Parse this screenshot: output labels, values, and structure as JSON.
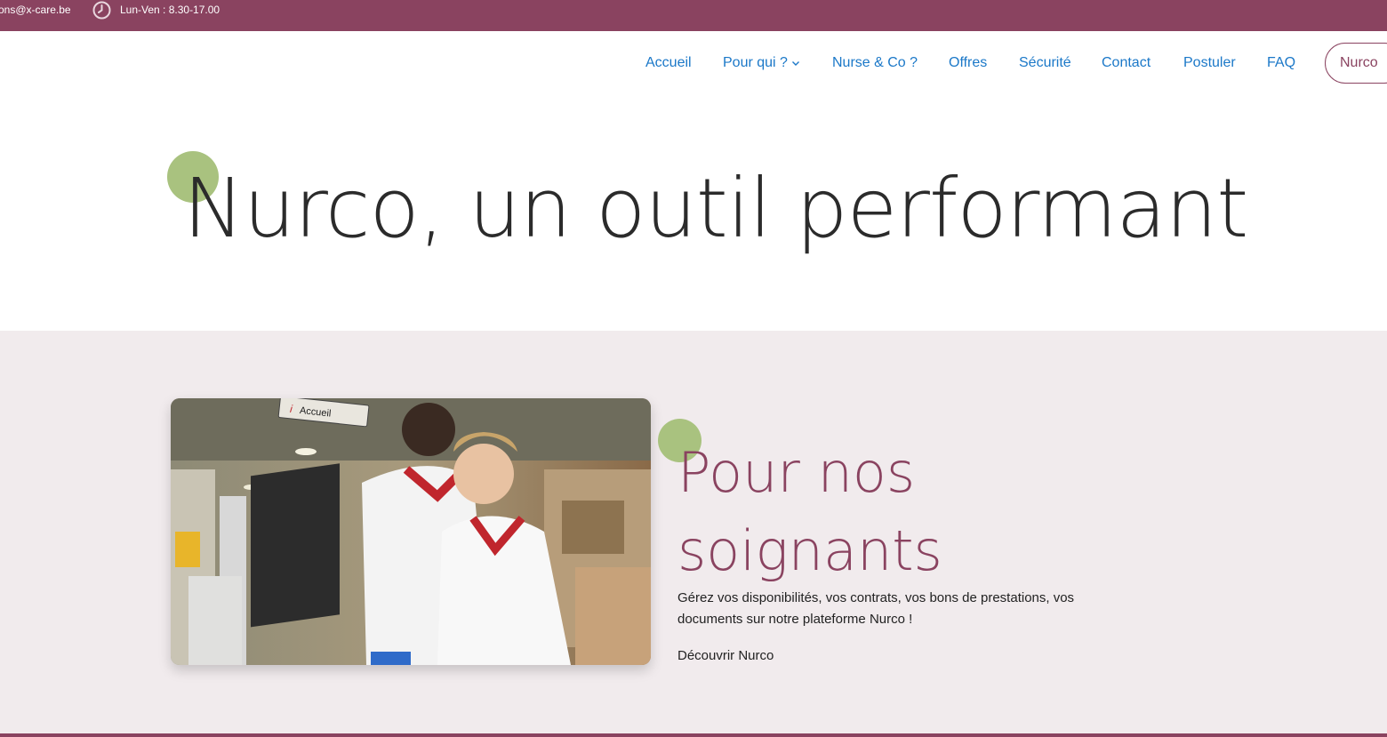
{
  "topbar": {
    "email": "ons@x-care.be",
    "hours": "Lun-Ven : 8.30-17.00",
    "clock_icon": "clock-icon"
  },
  "nav": {
    "items": [
      {
        "label": "Accueil"
      },
      {
        "label": "Pour qui ?"
      },
      {
        "label": "Nurse & Co ?"
      },
      {
        "label": "Offres"
      },
      {
        "label": "Sécurité"
      },
      {
        "label": "Contact"
      },
      {
        "label": "Postuler"
      },
      {
        "label": "FAQ"
      }
    ],
    "nurco_button": "Nurco"
  },
  "hero": {
    "title": "Nurco, un outil performant"
  },
  "feature": {
    "heading_line1": "Pour nos",
    "heading_line2": "soignants",
    "description": "Gérez vos disponibilités, vos contrats, vos bons de prestations, vos documents sur notre plateforme Nurco !",
    "cta": "Découvrir Nurco",
    "photo_sign": "Accueil"
  },
  "colors": {
    "brand": "#8a4360",
    "accent_dot": "#a9c27f",
    "nav_link": "#1b78c8",
    "section_bg": "#f1ebed"
  }
}
